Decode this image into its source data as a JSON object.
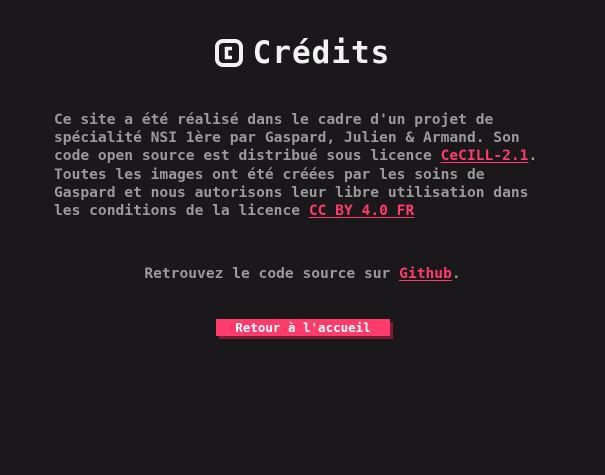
{
  "header": {
    "title": "Crédits",
    "icon": "copyright-icon"
  },
  "credits": {
    "text_1": "Ce site a été réalisé dans le cadre d'un projet de spécialité NSI 1ère par Gaspard, Julien & Armand. Son code open source est distribué sous licence ",
    "license_code_link": "CeCILL-2.1",
    "text_2": ". Toutes les images ont été créées par les soins de Gaspard et nous autorisons leur libre utilisation dans les conditions de la licence ",
    "license_images_link": "CC BY 4.0 FR"
  },
  "source": {
    "prefix": "Retrouvez le code source sur ",
    "link": "Github",
    "suffix": "."
  },
  "back_button": {
    "label": "Retour à l'accueil"
  },
  "colors": {
    "background": "#1a181a",
    "text": "#9a9a9a",
    "title": "#f2f2f2",
    "accent": "#ff3b6b"
  }
}
